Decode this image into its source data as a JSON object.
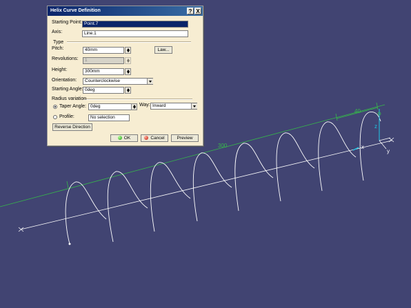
{
  "colors": {
    "background": "#414472",
    "geometry_white": "#ffffff",
    "axis_green": "#36b84a",
    "dialog_bg": "#f7edd2",
    "titlebar": "#0a246a"
  },
  "dialog": {
    "title": "Helix Curve Definition",
    "help_label": "?",
    "close_label": "X",
    "starting_point": {
      "label": "Starting Point:",
      "value": "Point.7"
    },
    "axis": {
      "label": "Axis:",
      "value": "Line.1"
    },
    "type_group_label": "Type",
    "pitch": {
      "label": "Pitch:",
      "value": "40mm"
    },
    "law_button_label": "Law...",
    "revolutions": {
      "label": "Revolutions:",
      "value": "1"
    },
    "height": {
      "label": "Height:",
      "value": "300mm"
    },
    "orientation": {
      "label": "Orientation:",
      "value": "Counterclockwise"
    },
    "starting_angle": {
      "label": "Starting Angle:",
      "value": "0deg"
    },
    "radius_group_label": "Radius variation",
    "taper_angle": {
      "label": "Taper Angle:",
      "value": "0deg",
      "selected": true
    },
    "way": {
      "label": "Way:",
      "value": "Inward"
    },
    "profile": {
      "label": "Profile:",
      "value": "No selection",
      "selected": false
    },
    "reverse_direction_label": "Reverse Direction",
    "ok_label": "OK",
    "cancel_label": "Cancel",
    "preview_label": "Preview"
  },
  "viewport": {
    "pitch_annotation": "40",
    "height_annotation": "300",
    "compass_x": "x",
    "compass_y": "y",
    "compass_z": "z"
  }
}
